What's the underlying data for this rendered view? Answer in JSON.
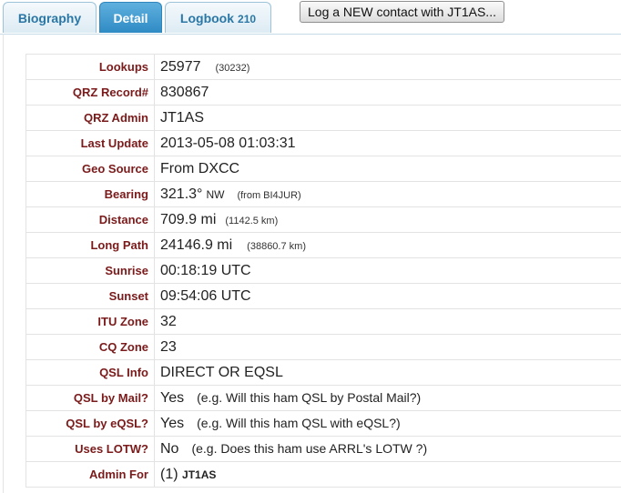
{
  "tabs": [
    {
      "label": "Biography"
    },
    {
      "label": "Detail"
    },
    {
      "label": "Logbook",
      "count": "210"
    }
  ],
  "log_button_label": "Log a NEW contact with JT1AS...",
  "details": {
    "lookups": {
      "label": "Lookups",
      "value": "25977",
      "extra": "(30232)"
    },
    "record": {
      "label": "QRZ Record#",
      "value": "830867"
    },
    "admin": {
      "label": "QRZ Admin",
      "value": "JT1AS"
    },
    "last_update": {
      "label": "Last Update",
      "value": "2013-05-08 01:03:31"
    },
    "geo_source": {
      "label": "Geo Source",
      "value": "From DXCC"
    },
    "bearing": {
      "label": "Bearing",
      "value": "321.3°",
      "direction": "NW",
      "extra": "(from BI4JUR)"
    },
    "distance": {
      "label": "Distance",
      "value": "709.9 mi",
      "extra": "(1142.5 km)"
    },
    "long_path": {
      "label": "Long Path",
      "value": "24146.9 mi",
      "extra": "(38860.7 km)"
    },
    "sunrise": {
      "label": "Sunrise",
      "value": "00:18:19 UTC"
    },
    "sunset": {
      "label": "Sunset",
      "value": "09:54:06 UTC"
    },
    "itu_zone": {
      "label": "ITU Zone",
      "value": "32"
    },
    "cq_zone": {
      "label": "CQ Zone",
      "value": "23"
    },
    "qsl_info": {
      "label": "QSL Info",
      "value": "DIRECT OR EQSL"
    },
    "qsl_mail": {
      "label": "QSL by Mail?",
      "value": "Yes",
      "note": "(e.g. Will this ham QSL by Postal Mail?)"
    },
    "qsl_eqsl": {
      "label": "QSL by eQSL?",
      "value": "Yes",
      "note": "(e.g. Will this ham QSL with eQSL?)"
    },
    "lotw": {
      "label": "Uses LOTW?",
      "value": "No",
      "note": "(e.g. Does this ham use ARRL's LOTW ?)"
    },
    "admin_for": {
      "label": "Admin For",
      "value": "(1)",
      "call": "JT1AS"
    }
  },
  "colors": {
    "label": "#7a1a1a",
    "tab_active": "#2f8bc4",
    "tab_text": "#2a77a6"
  }
}
